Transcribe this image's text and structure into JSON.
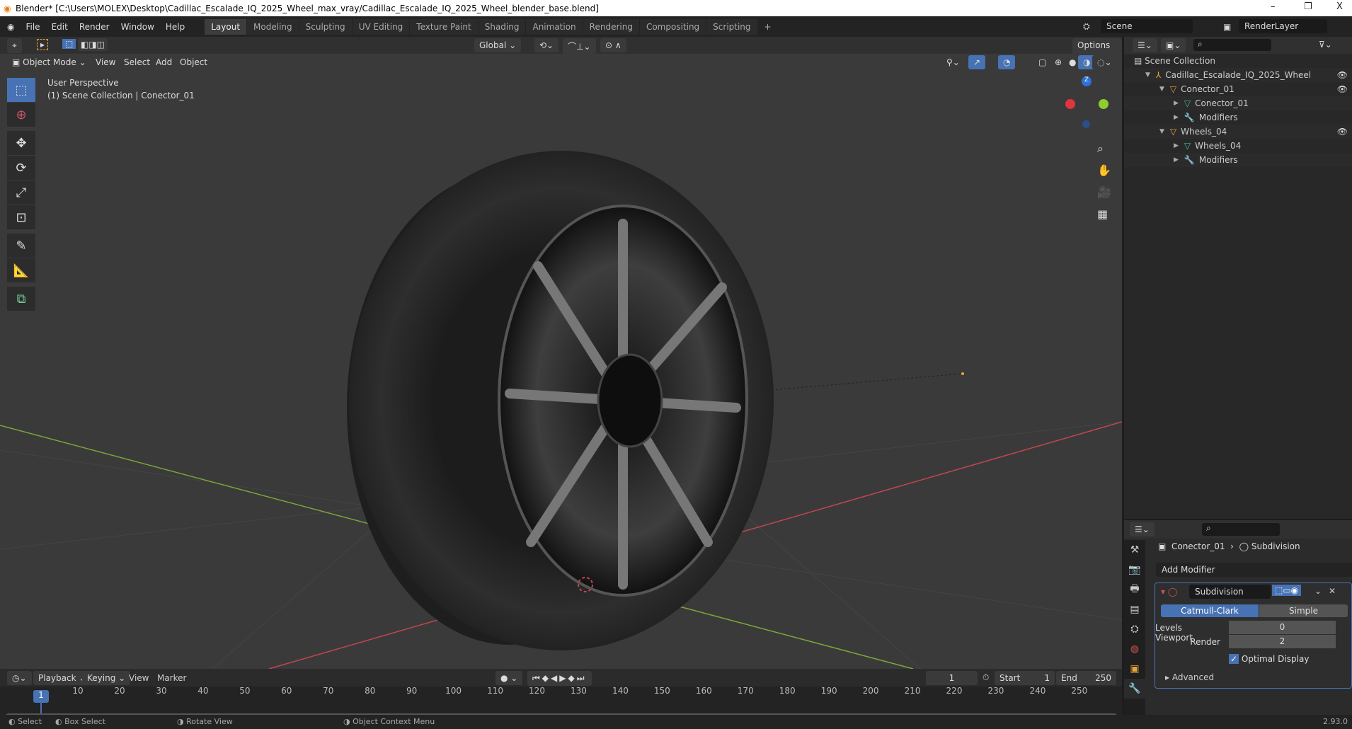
{
  "window": {
    "title": "Blender* [C:\\Users\\MOLEX\\Desktop\\Cadillac_Escalade_IQ_2025_Wheel_max_vray/Cadillac_Escalade_IQ_2025_Wheel_blender_base.blend]",
    "minimize": "–",
    "maximize": "❐",
    "close": "X"
  },
  "menu": [
    "File",
    "Edit",
    "Render",
    "Window",
    "Help"
  ],
  "workspaces": [
    "Layout",
    "Modeling",
    "Sculpting",
    "UV Editing",
    "Texture Paint",
    "Shading",
    "Animation",
    "Rendering",
    "Compositing",
    "Scripting",
    "+"
  ],
  "active_workspace": "Layout",
  "scene": "Scene",
  "view_layer": "RenderLayer",
  "tool_header": {
    "orientation": "Global",
    "options": "Options"
  },
  "viewport_header": {
    "mode": "Object Mode",
    "menus": [
      "View",
      "Select",
      "Add",
      "Object"
    ]
  },
  "overlay": {
    "line1": "User Perspective",
    "line2": "(1) Scene Collection | Conector_01"
  },
  "gizmo": {
    "z": "Z"
  },
  "outliner": {
    "root": "Scene Collection",
    "items": [
      {
        "label": "Cadillac_Escalade_IQ_2025_Wheel",
        "icon": "empty-icon",
        "depth": 0,
        "eye": true
      },
      {
        "label": "Conector_01",
        "icon": "object-icon",
        "depth": 1,
        "eye": true
      },
      {
        "label": "Conector_01",
        "icon": "mesh-icon",
        "depth": 2,
        "eye": false
      },
      {
        "label": "Modifiers",
        "icon": "wrench-icon",
        "depth": 2,
        "eye": false
      },
      {
        "label": "Wheels_04",
        "icon": "object-icon",
        "depth": 1,
        "eye": true
      },
      {
        "label": "Wheels_04",
        "icon": "mesh-icon",
        "depth": 2,
        "eye": false
      },
      {
        "label": "Modifiers",
        "icon": "wrench-icon",
        "depth": 2,
        "eye": false
      }
    ]
  },
  "properties": {
    "breadcrumb_object": "Conector_01",
    "breadcrumb_modifier": "Subdivision",
    "add_modifier": "Add Modifier",
    "modifier_name": "Subdivision",
    "tabs": [
      "Catmull-Clark",
      "Simple"
    ],
    "active_tab": "Catmull-Clark",
    "levels_viewport_label": "Levels Viewport",
    "levels_viewport": "0",
    "render_label": "Render",
    "render": "2",
    "optimal_display": "Optimal Display",
    "optimal_checked": true,
    "advanced": "Advanced"
  },
  "timeline": {
    "menus": [
      "Playback",
      "Keying",
      "View",
      "Marker"
    ],
    "current_frame": "1",
    "start_label": "Start",
    "start": "1",
    "end_label": "End",
    "end": "250",
    "ticks": [
      "10",
      "20",
      "30",
      "40",
      "50",
      "60",
      "70",
      "80",
      "90",
      "100",
      "110",
      "120",
      "130",
      "140",
      "150",
      "160",
      "170",
      "180",
      "190",
      "200",
      "210",
      "220",
      "230",
      "240",
      "250"
    ]
  },
  "status": {
    "items": [
      "Select",
      "Box Select",
      "Rotate View",
      "Object Context Menu"
    ],
    "version": "2.93.0"
  },
  "colors": {
    "accent": "#4772b3",
    "x_axis": "#c0474f",
    "y_axis": "#7aa63a"
  }
}
